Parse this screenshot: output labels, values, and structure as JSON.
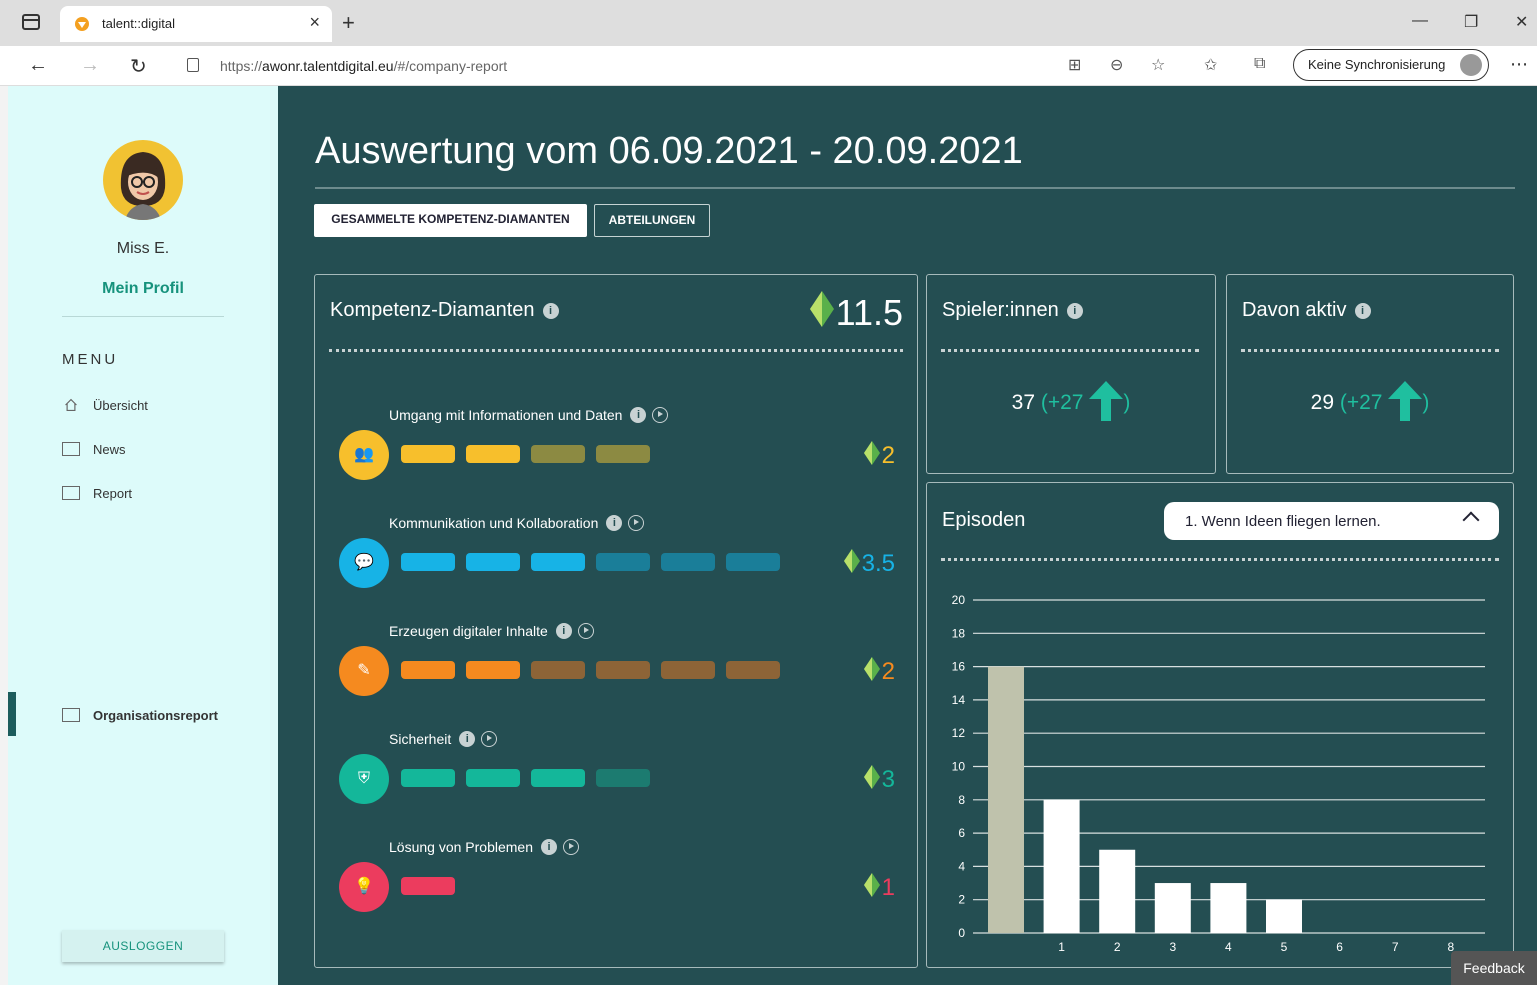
{
  "browser": {
    "tab_title": "talent::digital",
    "url_prefix": "https://",
    "url_domain": "awonr.talentdigital.eu",
    "url_path": "/#/company-report",
    "sync_label": "Keine Synchronisierung"
  },
  "sidebar": {
    "user_name": "Miss E.",
    "profile_link": "Mein Profil",
    "menu_title": "MENU",
    "items": [
      {
        "label": "Übersicht",
        "icon": "home-icon"
      },
      {
        "label": "News",
        "icon": "news-icon"
      },
      {
        "label": "Report",
        "icon": "report-icon"
      }
    ],
    "active_item": {
      "label": "Organisationsreport",
      "icon": "report-icon"
    },
    "logout_label": "AUSLOGGEN"
  },
  "main": {
    "title": "Auswertung vom 06.09.2021 - 20.09.2021",
    "buttons": {
      "collected": "GESAMMELTE KOMPETENZ-DIAMANTEN",
      "departments": "ABTEILUNGEN"
    },
    "diamonds_card": {
      "title": "Kompetenz-Diamanten",
      "total": "11.5",
      "competences": [
        {
          "label": "Umgang mit Informationen und Daten",
          "score": "2",
          "color": "#f7bf2c",
          "dim_color": "#8c8a42",
          "filled": 2,
          "total": 4,
          "icon": "users-icon"
        },
        {
          "label": "Kommunikation und Kollaboration",
          "score": "3.5",
          "color": "#17b3e6",
          "dim_color": "#1a7e99",
          "filled": 3,
          "total": 6,
          "icon": "chat-icon"
        },
        {
          "label": "Erzeugen digitaler Inhalte",
          "score": "2",
          "color": "#f58a1f",
          "dim_color": "#8d6437",
          "filled": 2,
          "total": 6,
          "icon": "edit-icon"
        },
        {
          "label": "Sicherheit",
          "score": "3",
          "color": "#14b79a",
          "dim_color": "#1c7b70",
          "filled": 3,
          "total": 4,
          "icon": "shield-icon"
        },
        {
          "label": "Lösung von Problemen",
          "score": "1",
          "color": "#ec3c5e",
          "dim_color": "#8a3a4a",
          "filled": 1,
          "total": 1,
          "icon": "lightbulb-icon"
        }
      ]
    },
    "players_card": {
      "title": "Spieler:innen",
      "value": "37",
      "delta": "(+27",
      "close": ")"
    },
    "active_card": {
      "title": "Davon aktiv",
      "value": "29",
      "delta": "(+27",
      "close": ")"
    },
    "episodes_card": {
      "title": "Episoden",
      "dropdown_value": "1. Wenn Ideen fliegen lernen."
    }
  },
  "chart_data": {
    "type": "bar",
    "title": "Episoden",
    "categories": [
      "",
      "1",
      "2",
      "3",
      "4",
      "5",
      "6",
      "7",
      "8"
    ],
    "values": [
      16,
      8,
      5,
      3,
      3,
      2,
      0,
      0,
      0
    ],
    "ylim": [
      0,
      20
    ],
    "yticks": [
      0,
      2,
      4,
      6,
      8,
      10,
      12,
      14,
      16,
      18,
      20
    ],
    "grid": true,
    "colors": [
      "#bfc2ac",
      "#ffffff"
    ]
  },
  "feedback_label": "Feedback"
}
